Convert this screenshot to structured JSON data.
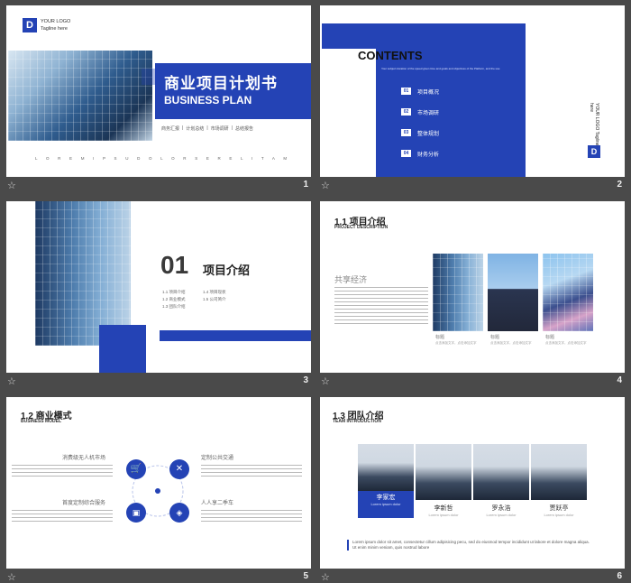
{
  "slides": [
    {
      "number": "1",
      "logo_letter": "D",
      "logo_line1": "YOUR LOGO",
      "logo_line2": "Tagline here",
      "title_cn": "商业项目计划书",
      "title_en": "BUSINESS PLAN",
      "tags": [
        "商务汇报",
        "|",
        "计划总结",
        "|",
        "市场调研",
        "|",
        "总结报告"
      ],
      "lorem_strip": "L O R E M  I P S U D O L O R S  E R E L I T A M"
    },
    {
      "number": "2",
      "heading": "CONTENTS",
      "subtext": "Your subject duration of the speed given time and goals and objectives of the Platform, and the use",
      "items": [
        {
          "num": "01",
          "label": "项目概况"
        },
        {
          "num": "02",
          "label": "市场调研"
        },
        {
          "num": "03",
          "label": "整体规划"
        },
        {
          "num": "04",
          "label": "财务分析"
        }
      ],
      "side_logo_letter": "D",
      "side_logo_text": "YOUR LOGO Tagline here"
    },
    {
      "number": "3",
      "big_num": "01",
      "title": "项目介绍",
      "sub_items": [
        "1.1 项目介绍",
        "1.4 项目现状",
        "1.2 商业模式",
        "1.5 公司简介",
        "1.3 团队介绍"
      ]
    },
    {
      "number": "4",
      "heading": "1.1 项目介绍",
      "subheading": "PROJECT DESCRIPTION",
      "left_title": "共享经济",
      "captions": [
        "标题",
        "标题",
        "标题"
      ],
      "caption_sub": [
        "点击添加文字，点击添加文字",
        "点击添加文字，点击添加文字",
        "点击添加文字，点击添加文字"
      ]
    },
    {
      "number": "5",
      "heading": "1.2 商业模式",
      "subheading": "BUSINESS MODEL",
      "labels": [
        "消费级无人机市场",
        "定制公共交通",
        "首度定制综合服务",
        "人人享二季车"
      ]
    },
    {
      "number": "6",
      "heading": "1.3 团队介绍",
      "subheading": "TEAM INTRODUCTION",
      "members": [
        {
          "name": "李家宏",
          "role": "Lorem ipsum dolor"
        },
        {
          "name": "李新哲",
          "role": "Lorem ipsum dolor"
        },
        {
          "name": "罗永浩",
          "role": "Lorem ipsum dolor"
        },
        {
          "name": "贾跃亭",
          "role": "Lorem ipsum dolor"
        }
      ],
      "dash": "—",
      "paragraph": "Lorem ipsum dolor sit amet, consectetur cillum adipisicing pecu, sed do eiusmod tempor incididunt ut labore et dolore magna aliqua. Ut enim minim veniam, quis nostrud labore"
    }
  ],
  "footer_icon": "☆"
}
